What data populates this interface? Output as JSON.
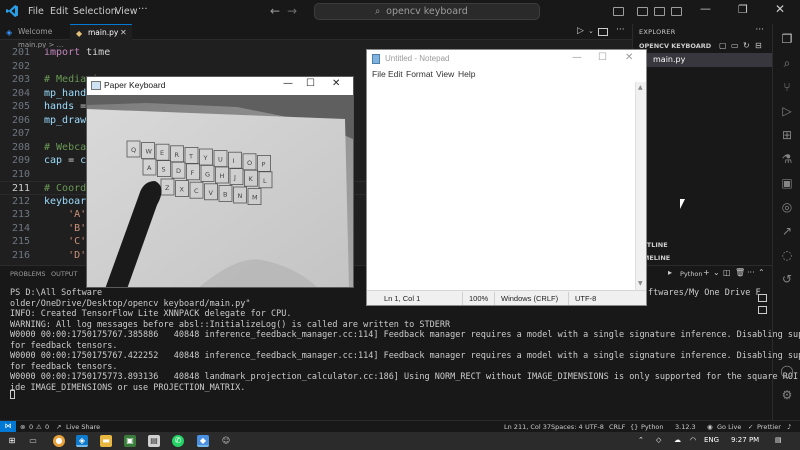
{
  "vscode": {
    "menu": [
      "File",
      "Edit",
      "Selection",
      "View"
    ],
    "command_center": "opencv keyboard",
    "tabs": [
      "Welcome",
      "main.py"
    ],
    "breadcrumb": "main.py > ...",
    "code_lines": [
      {
        "ln": "201",
        "parts": [
          [
            "kw",
            "import"
          ],
          [
            "pl",
            " time"
          ]
        ]
      },
      {
        "ln": "202",
        "parts": []
      },
      {
        "ln": "203",
        "parts": [
          [
            "cm",
            "# Mediapipe"
          ]
        ]
      },
      {
        "ln": "204",
        "parts": [
          [
            "id",
            "mp_hands"
          ]
        ]
      },
      {
        "ln": "205",
        "parts": [
          [
            "id",
            "hands"
          ],
          [
            "pl",
            " ="
          ]
        ]
      },
      {
        "ln": "206",
        "parts": [
          [
            "id",
            "mp_draw"
          ]
        ]
      },
      {
        "ln": "207",
        "parts": []
      },
      {
        "ln": "208",
        "parts": [
          [
            "cm",
            "# Webcam"
          ]
        ]
      },
      {
        "ln": "209",
        "parts": [
          [
            "id",
            "cap"
          ],
          [
            "pl",
            " = "
          ],
          [
            "id",
            "cv"
          ]
        ]
      },
      {
        "ln": "210",
        "parts": []
      },
      {
        "ln": "211",
        "parts": [
          [
            "cm",
            "# Coordi"
          ]
        ]
      },
      {
        "ln": "212",
        "parts": [
          [
            "id",
            "keyboard"
          ]
        ]
      },
      {
        "ln": "213",
        "parts": [
          [
            "pl",
            "    "
          ],
          [
            "st",
            "'A':"
          ]
        ]
      },
      {
        "ln": "214",
        "parts": [
          [
            "pl",
            "    "
          ],
          [
            "st",
            "'B':"
          ]
        ]
      },
      {
        "ln": "215",
        "parts": [
          [
            "pl",
            "    "
          ],
          [
            "st",
            "'C':"
          ]
        ]
      },
      {
        "ln": "216",
        "parts": [
          [
            "pl",
            "    "
          ],
          [
            "st",
            "'D':"
          ]
        ]
      }
    ],
    "explorer": {
      "title": "EXPLORER",
      "folder": "OPENCV KEYBOARD",
      "file": "main.py",
      "outline": "OUTLINE",
      "timeline": "TIMELINE"
    },
    "panel": {
      "tabs": [
        "PROBLEMS",
        "OUTPUT"
      ],
      "terminal_name": "Python",
      "terminal_lines": [
        "PS D:\\All Software",
        "older/OneDrive/Desktop/opencv keyboard/main.py\"",
        "INFO: Created TensorFlow Lite XNNPACK delegate for CPU.",
        "WARNING: All log messages before absl::InitializeLog() is called are written to STDERR",
        "W0000 00:00:1750175767.385886   40848 inference_feedback_manager.cc:114] Feedback manager requires a model with a single signature inference. Disabling support",
        "for feedback tensors.",
        "W0000 00:00:1750175767.422252   40848 inference_feedback_manager.cc:114] Feedback manager requires a model with a single signature inference. Disabling support",
        "for feedback tensors.",
        "W0000 00:00:1750175773.893136   40848 landmark_projection_calculator.cc:186] Using NORM_RECT without IMAGE_DIMENSIONS is only supported for the square ROI. Provi",
        "ide IMAGE_DIMENSIONS or use PROJECTION_MATRIX."
      ],
      "term_line1_tail": "\"D",
      "term_line1_tail2": "ftwares/My One Drive F"
    },
    "status": {
      "errors": "0",
      "warnings": "0",
      "live_share": "Live Share",
      "position": "Ln 211, Col 37",
      "spaces": "Spaces: 4",
      "encoding": "UTF-8",
      "eol": "CRLF",
      "language": "Python",
      "version": "3.12.3",
      "go_live": "Go Live",
      "prettier": "Prettier"
    }
  },
  "paper_keyboard": {
    "title": "Paper Keyboard",
    "rows": [
      [
        "Q",
        "W",
        "E",
        "R",
        "T",
        "Y",
        "U",
        "I",
        "O",
        "P"
      ],
      [
        "A",
        "S",
        "D",
        "F",
        "G",
        "H",
        "J",
        "K",
        "L"
      ],
      [
        "Z",
        "X",
        "C",
        "V",
        "B",
        "N",
        "M"
      ]
    ]
  },
  "notepad": {
    "title": "Untitled - Notepad",
    "menu": [
      "File",
      "Edit",
      "Format",
      "View",
      "Help"
    ],
    "status": {
      "position": "Ln 1, Col 1",
      "zoom": "100%",
      "eol": "Windows (CRLF)",
      "encoding": "UTF-8"
    }
  },
  "taskbar": {
    "language": "ENG",
    "time": "9:27 PM"
  },
  "colors": {
    "accent": "#0078d4",
    "editor_bg": "#1f1f1f",
    "sidebar_bg": "#181818"
  }
}
